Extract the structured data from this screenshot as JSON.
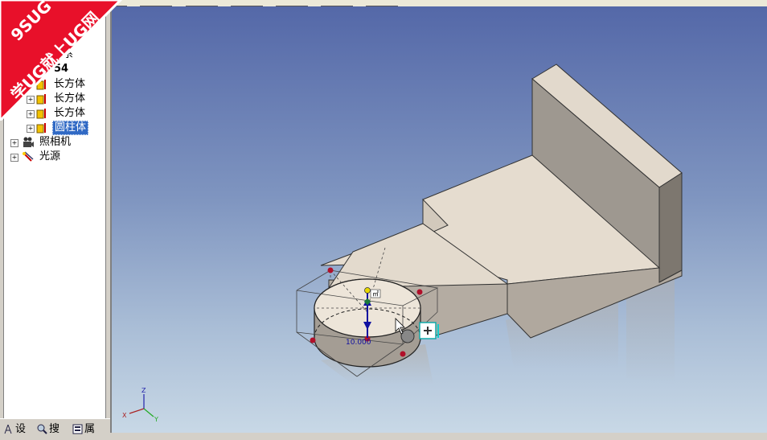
{
  "tree": {
    "items": [
      {
        "label": "标系",
        "level": 0,
        "selected": false
      },
      {
        "label": "54",
        "level": 0,
        "selected": false
      },
      {
        "label": "长方体",
        "level": 1,
        "selected": false
      },
      {
        "label": "长方体",
        "level": 1,
        "selected": false
      },
      {
        "label": "长方体",
        "level": 1,
        "selected": false
      },
      {
        "label": "圆柱体",
        "level": 1,
        "selected": true
      },
      {
        "label": "照相机",
        "level": 0,
        "selected": false
      },
      {
        "label": "光源",
        "level": 0,
        "selected": false
      }
    ]
  },
  "tabs": [
    {
      "label": "设"
    },
    {
      "label": "搜"
    },
    {
      "label": "属"
    }
  ],
  "watermark": {
    "line1": "9SUG",
    "line2": "学UG就上UG网"
  },
  "viewport": {
    "dimension_label": "10.000",
    "axes": {
      "x": "X",
      "y": "Y",
      "z": "Z"
    }
  }
}
